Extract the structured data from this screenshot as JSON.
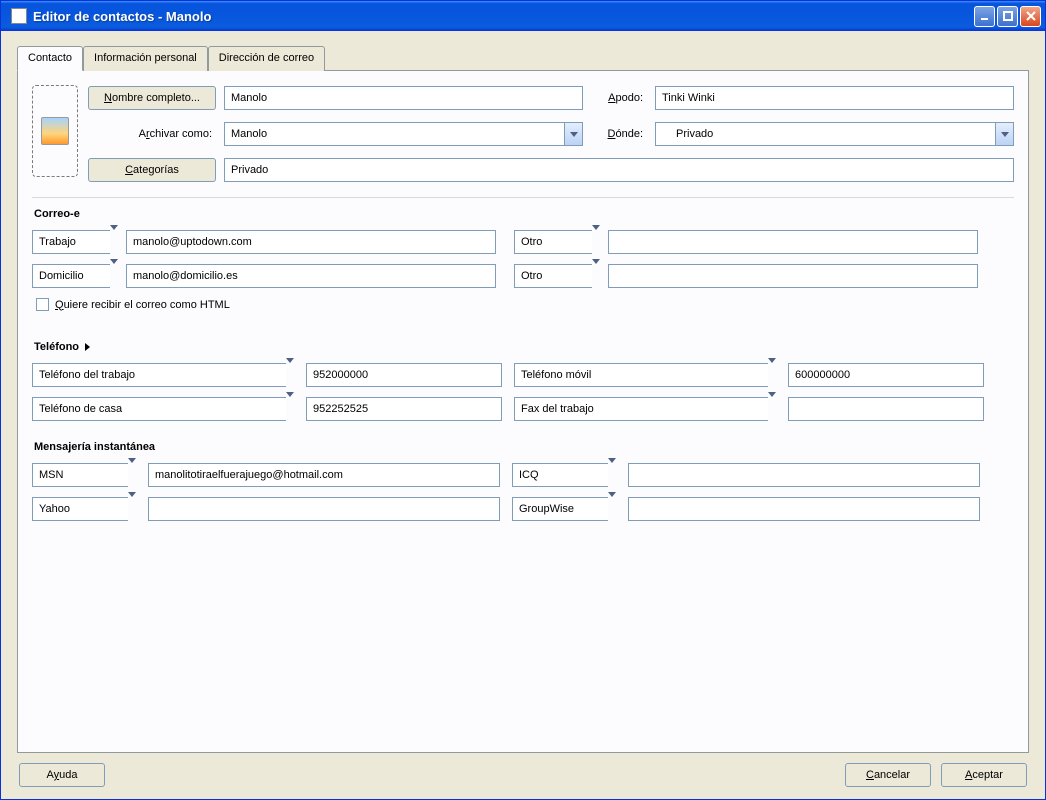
{
  "window": {
    "title": "Editor de contactos - Manolo"
  },
  "tabs": {
    "contact": "Contacto",
    "personal": "Información personal",
    "mailing": "Dirección de correo"
  },
  "header": {
    "fullname_btn": "Nombre completo...",
    "fullname_value": "Manolo",
    "nickname_label": "Apodo:",
    "nickname_value": "Tinki Winki",
    "fileas_label": "Archivar como:",
    "fileas_value": "Manolo",
    "where_label": "Dónde:",
    "where_value": "Privado",
    "categories_btn": "Categorías",
    "categories_value": "Privado"
  },
  "email": {
    "section": "Correo-e",
    "rows": [
      {
        "type": "Trabajo",
        "value": "manolo@uptodown.com",
        "type2": "Otro",
        "value2": ""
      },
      {
        "type": "Domicilio",
        "value": "manolo@domicilio.es",
        "type2": "Otro",
        "value2": ""
      }
    ],
    "html_checkbox": "Quiere recibir el correo como HTML"
  },
  "phone": {
    "section": "Teléfono",
    "rows": [
      {
        "type1": "Teléfono del trabajo",
        "val1": "952000000",
        "type2": "Teléfono móvil",
        "val2": "600000000"
      },
      {
        "type1": "Teléfono de casa",
        "val1": "952252525",
        "type2": "Fax del trabajo",
        "val2": ""
      }
    ]
  },
  "im": {
    "section": "Mensajería instantánea",
    "rows": [
      {
        "type1": "MSN",
        "val1": "manolitotiraelfuerajuego@hotmail.com",
        "type2": "ICQ",
        "val2": ""
      },
      {
        "type1": "Yahoo",
        "val1": "",
        "type2": "GroupWise",
        "val2": ""
      }
    ]
  },
  "footer": {
    "help": "Ayuda",
    "cancel": "Cancelar",
    "accept": "Aceptar"
  }
}
